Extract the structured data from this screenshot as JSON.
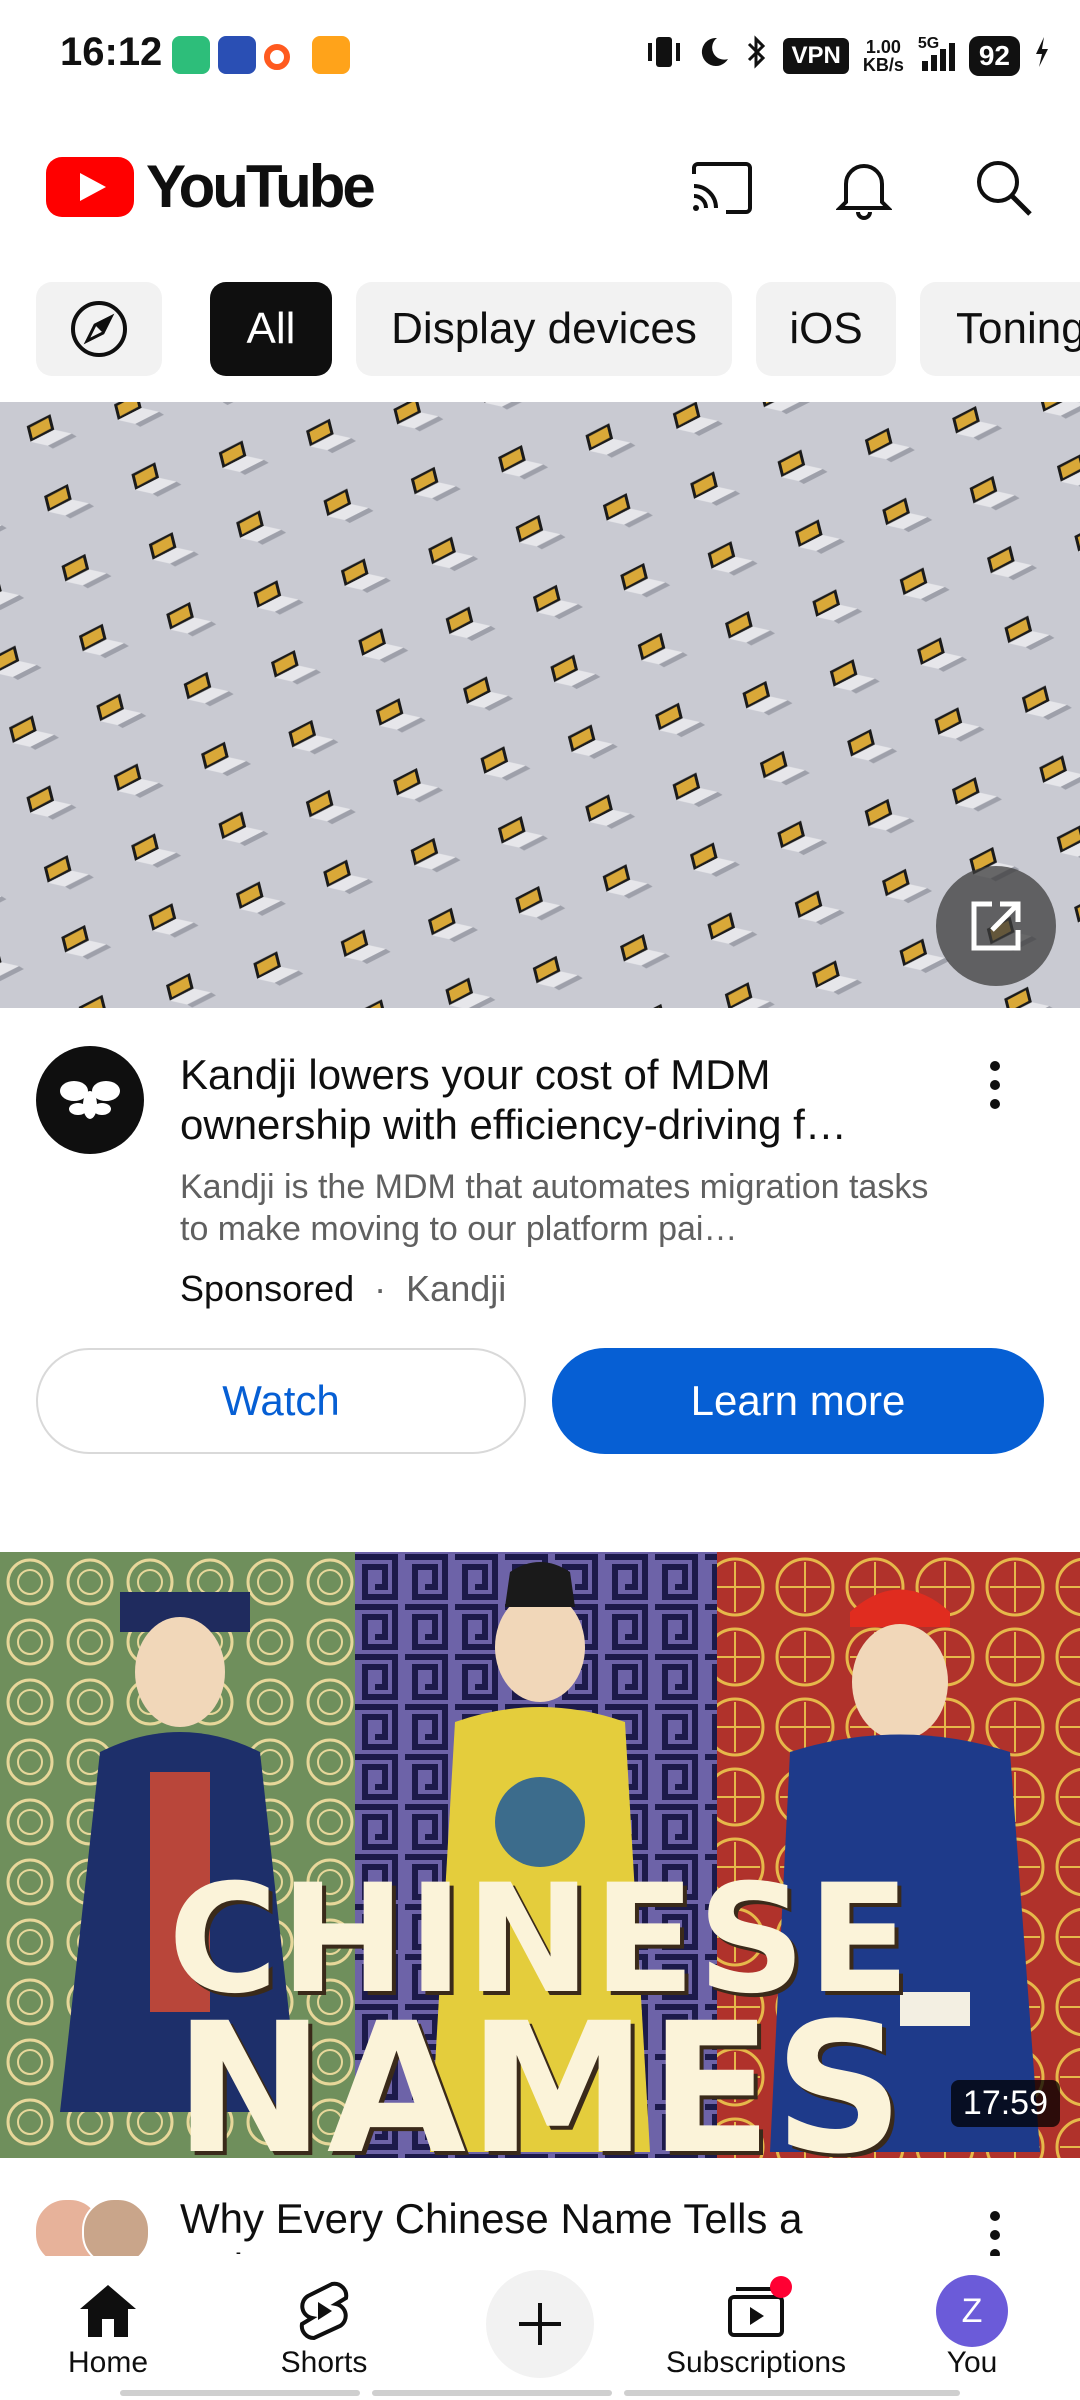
{
  "status_bar": {
    "time": "16:12",
    "vpn": "VPN",
    "speed_value": "1.00",
    "speed_unit": "KB/s",
    "network": "5G",
    "battery": "92"
  },
  "header": {
    "logo_text": "YouTube"
  },
  "chips": [
    {
      "label": ""
    },
    {
      "label": "All"
    },
    {
      "label": "Display devices"
    },
    {
      "label": "iOS"
    },
    {
      "label": "Toning"
    }
  ],
  "ad": {
    "title": "Kandji lowers your cost of MDM ownership with efficiency-driving f…",
    "description": "Kandji is the MDM that automates migration tasks to make moving to our platform pai…",
    "sponsored": "Sponsored",
    "separator": "·",
    "advertiser": "Kandji",
    "watch_label": "Watch",
    "learn_more_label": "Learn more"
  },
  "video": {
    "thumbnail_line1": "CHINESE",
    "thumbnail_line2": "NAMES",
    "duration": "17:59",
    "title": "Why Every Chinese Name Tells a Unique S…"
  },
  "bottom_nav": {
    "home": "Home",
    "shorts": "Shorts",
    "subscriptions": "Subscriptions",
    "you": "You",
    "you_initial": "Z"
  },
  "colors": {
    "brand_red": "#ff0000",
    "link_blue": "#065fd4",
    "chip_bg": "#f2f2f2",
    "chip_active_bg": "#0f0f0f"
  }
}
